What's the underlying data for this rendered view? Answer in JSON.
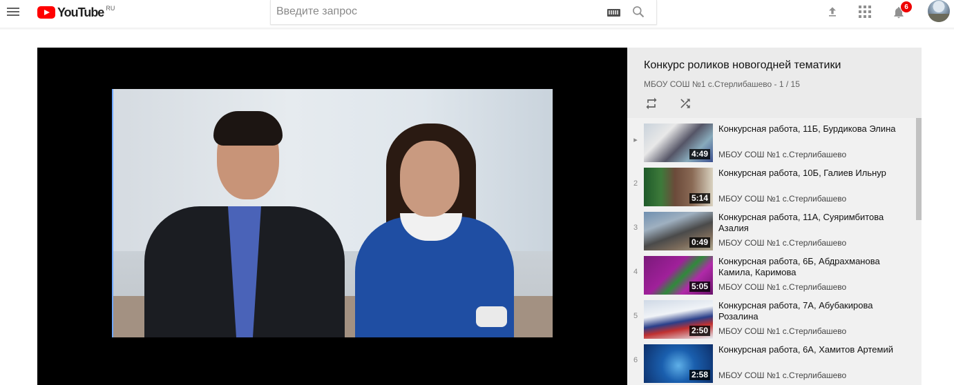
{
  "header": {
    "logo_text": "YouTube",
    "region": "RU",
    "search_placeholder": "Введите запрос",
    "notification_count": "6"
  },
  "playlist": {
    "title": "Конкурс роликов новогодней тематики",
    "meta": "МБОУ СОШ №1 с.Стерлибашево - 1 / 15",
    "items": [
      {
        "index": "▸",
        "title": "Конкурсная работа, 11Б, Бурдикова Элина",
        "channel": "МБОУ СОШ №1 с.Стерлибашево",
        "duration": "4:49"
      },
      {
        "index": "2",
        "title": "Конкурсная работа, 10Б, Галиев Ильнур",
        "channel": "МБОУ СОШ №1 с.Стерлибашево",
        "duration": "5:14"
      },
      {
        "index": "3",
        "title": "Конкурсная работа, 11А, Суяримбитова Азалия",
        "channel": "МБОУ СОШ №1 с.Стерлибашево",
        "duration": "0:49"
      },
      {
        "index": "4",
        "title": "Конкурсная работа, 6Б, Абдрахманова Камила, Каримова",
        "channel": "МБОУ СОШ №1 с.Стерлибашево",
        "duration": "5:05"
      },
      {
        "index": "5",
        "title": "Конкурсная работа, 7А, Абубакирова Розалина",
        "channel": "МБОУ СОШ №1 с.Стерлибашево",
        "duration": "2:50"
      },
      {
        "index": "6",
        "title": "Конкурсная работа, 6А, Хамитов Артемий",
        "channel": "МБОУ СОШ №1 с.Стерлибашево",
        "duration": "2:58"
      }
    ]
  },
  "icons": {
    "menu": "menu-icon",
    "keyboard": "keyboard-icon",
    "search": "search-icon",
    "upload": "upload-icon",
    "apps": "apps-icon",
    "notifications": "bell-icon",
    "loop": "loop-icon",
    "shuffle": "shuffle-icon"
  },
  "colors": {
    "brand_red": "#ff0000",
    "badge_red": "#ee0000"
  }
}
